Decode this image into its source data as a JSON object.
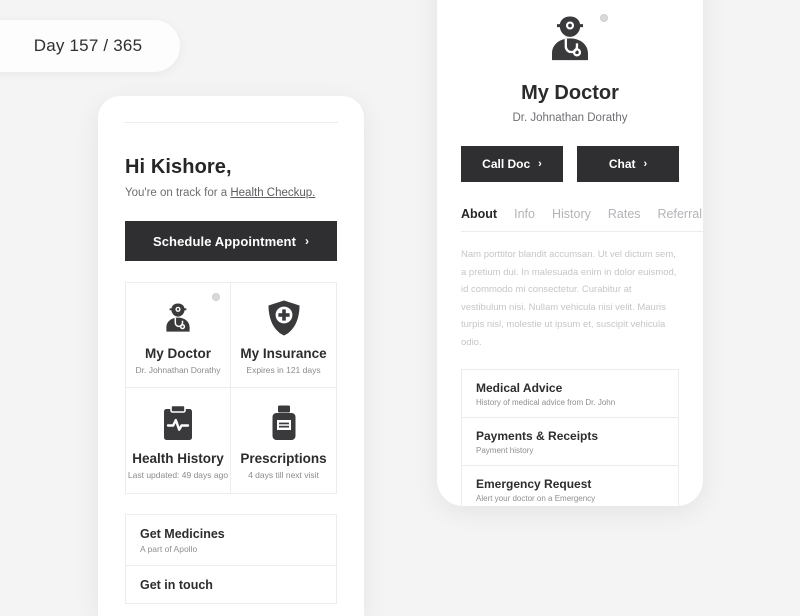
{
  "badge": {
    "label": "Day 157 / 365"
  },
  "colors": {
    "background": "#f4f4f4",
    "card": "#ffffff",
    "dark": "#2f2f31",
    "icon": "#3a3a3c",
    "muted": "#8b8b90",
    "faint": "#c6c6ca",
    "border": "#ececec",
    "dot_badge": "#d9d9db"
  },
  "left_phone": {
    "greeting": "Hi Kishore,",
    "subtitle_prefix": "You're on track for a ",
    "subtitle_link": "Health Checkup.",
    "cta": {
      "label": "Schedule Appointment",
      "chevron": "›"
    },
    "cards": [
      {
        "icon": "doctor-icon",
        "title": "My Doctor",
        "subtitle": "Dr. Johnathan Dorathy",
        "badge": true
      },
      {
        "icon": "shield-plus-icon",
        "title": "My Insurance",
        "subtitle": "Expires in 121 days",
        "badge": false
      },
      {
        "icon": "clipboard-pulse-icon",
        "title": "Health History",
        "subtitle": "Last updated: 49 days ago",
        "badge": false
      },
      {
        "icon": "medicine-bottle-icon",
        "title": "Prescriptions",
        "subtitle": "4 days till next visit",
        "badge": false
      }
    ],
    "list": [
      {
        "title": "Get Medicines",
        "subtitle": "A part of Apollo"
      },
      {
        "title": "Get in touch",
        "subtitle": ""
      }
    ]
  },
  "right_phone": {
    "profile": {
      "icon": "doctor-icon",
      "name": "My Doctor",
      "subtitle": "Dr. Johnathan Dorathy",
      "badge": true
    },
    "actions": [
      {
        "label": "Call Doc",
        "chevron": "›"
      },
      {
        "label": "Chat",
        "chevron": "›"
      }
    ],
    "tabs": [
      {
        "label": "About",
        "active": true
      },
      {
        "label": "Info",
        "active": false
      },
      {
        "label": "History",
        "active": false
      },
      {
        "label": "Rates",
        "active": false
      },
      {
        "label": "Referral",
        "active": false
      }
    ],
    "body_text": "Nam porttitor blandit accumsan. Ut vel dictum sem, a pretium dui. In malesuada enim in dolor euismod, id commodo mi consectetur. Curabitur at vestibulum nisi. Nullam vehicula nisi velit. Mauris turpis nisl, molestie ut ipsum et, suscipit vehicula odio.",
    "list": [
      {
        "title": "Medical Advice",
        "subtitle": "History of medical advice from Dr. John"
      },
      {
        "title": "Payments & Receipts",
        "subtitle": "Payment history"
      },
      {
        "title": "Emergency Request",
        "subtitle": "Alert your doctor on a Emergency"
      }
    ]
  }
}
